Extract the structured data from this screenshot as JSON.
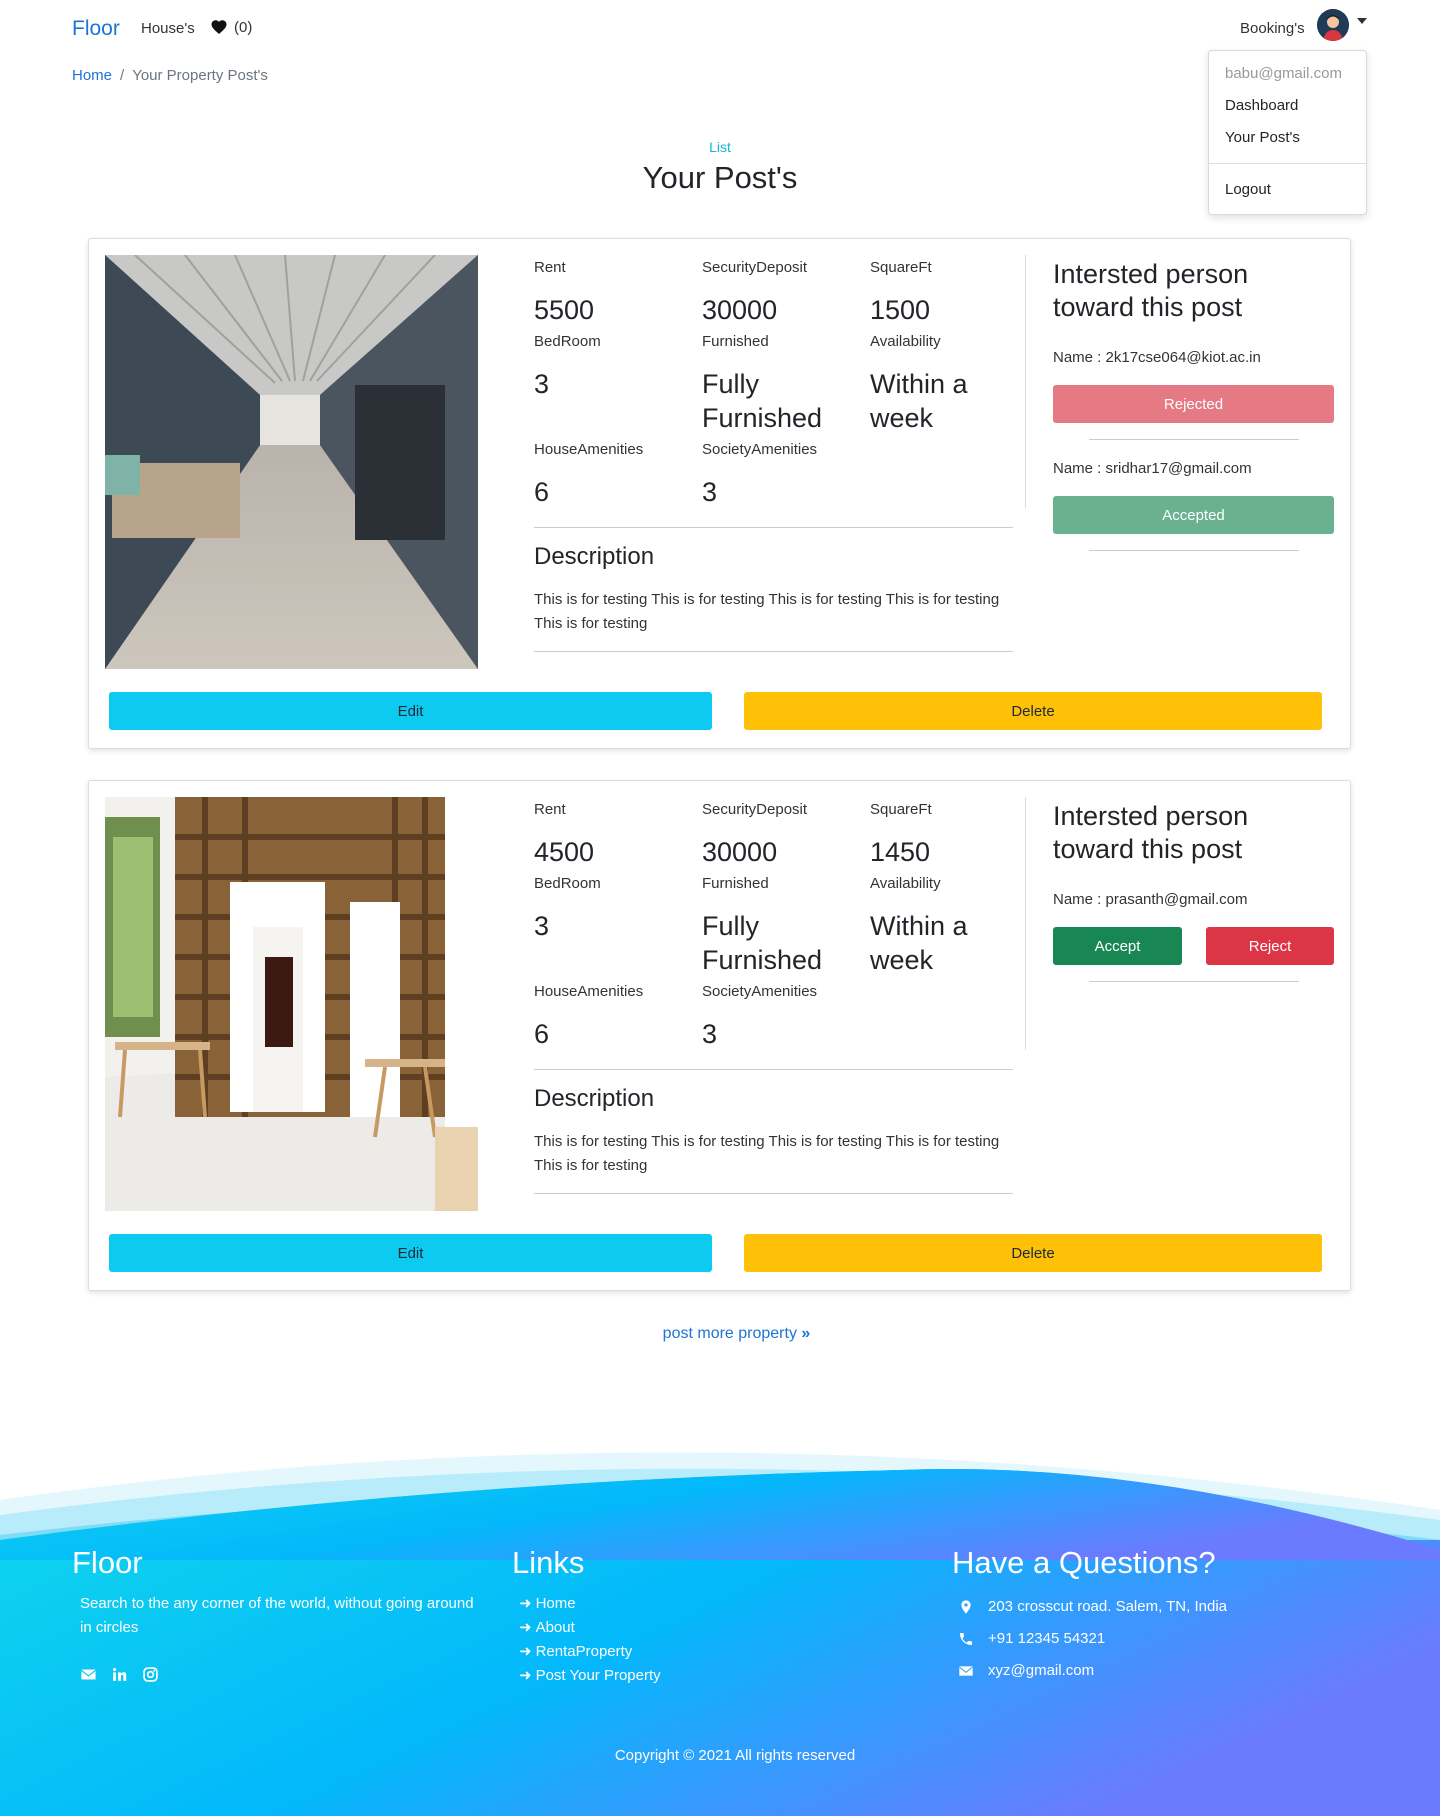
{
  "nav": {
    "brand": "Floor",
    "houses": "House's",
    "fav_count": "(0)",
    "bookings": "Booking's"
  },
  "dropdown": {
    "email": "babu@gmail.com",
    "dashboard": "Dashboard",
    "posts": "Your Post's",
    "logout": "Logout"
  },
  "breadcrumb": {
    "home": "Home",
    "separator": "/",
    "current": "Your Property Post's"
  },
  "section": {
    "tag": "List",
    "title": "Your Post's"
  },
  "labels": {
    "rent": "Rent",
    "deposit": "SecurityDeposit",
    "sqft": "SquareFt",
    "bedroom": "BedRoom",
    "furnished": "Furnished",
    "availability": "Availability",
    "house_amenities": "HouseAmenities",
    "society_amenities": "SocietyAmenities",
    "description": "Description",
    "interested_title": "Intersted person toward this post",
    "edit": "Edit",
    "delete": "Delete"
  },
  "posts": [
    {
      "rent": "5500",
      "deposit": "30000",
      "sqft": "1500",
      "bedroom": "3",
      "furnished": "Fully Furnished",
      "availability": "Within a week",
      "house_amenities": "6",
      "society_amenities": "3",
      "description": "This is for testing This is for testing This is for testing This is for testing This is for testing",
      "interested": [
        {
          "name": "Name : 2k17cse064@kiot.ac.in",
          "status": "Rejected"
        },
        {
          "name": "Name : sridhar17@gmail.com",
          "status": "Accepted"
        }
      ]
    },
    {
      "rent": "4500",
      "deposit": "30000",
      "sqft": "1450",
      "bedroom": "3",
      "furnished": "Fully Furnished",
      "availability": "Within a week",
      "house_amenities": "6",
      "society_amenities": "3",
      "description": "This is for testing This is for testing This is for testing This is for testing This is for testing",
      "interested": [
        {
          "name": "Name : prasanth@gmail.com",
          "accept": "Accept",
          "reject": "Reject"
        }
      ]
    }
  ],
  "more_link": "post more property",
  "footer": {
    "brand": "Floor",
    "tagline": "Search to the any corner of the world, without going around in circles",
    "links_title": "Links",
    "links": [
      "Home",
      "About",
      "RentaProperty",
      "Post Your Property"
    ],
    "questions_title": "Have a Questions?",
    "address": "203 crosscut road. Salem, TN, India",
    "phone": "+91 12345 54321",
    "email": "xyz@gmail.com",
    "copyright": "Copyright © 2021 All rights reserved",
    "social_icons": [
      "envelope-icon",
      "linkedin-icon",
      "instagram-icon"
    ]
  },
  "colors": {
    "primary_link": "#1e74d6",
    "info": "#0dcaf0",
    "warning": "#ffc107",
    "success": "#198754",
    "danger": "#dc3545"
  }
}
